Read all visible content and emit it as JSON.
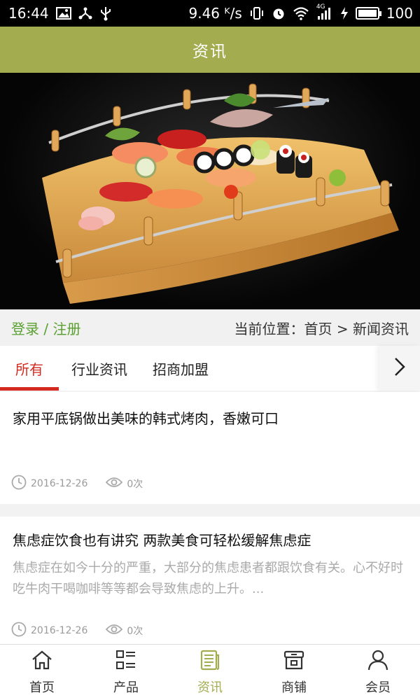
{
  "status_bar": {
    "time": "16:44",
    "speed": "9.46 ᴷ/s",
    "network": "4G",
    "battery": "100",
    "battery_level": 1.0,
    "left_icons": [
      "image-icon",
      "share-icon",
      "usb-icon"
    ],
    "right_icons": [
      "vibrate-icon",
      "alarm-icon",
      "wifi-icon",
      "signal-icon",
      "charging-icon",
      "battery-icon"
    ]
  },
  "header": {
    "title": "资讯"
  },
  "hero": {
    "image_description": "sushi platter on wooden bridge boat"
  },
  "info_bar": {
    "login": "登录",
    "separator": " / ",
    "register": "注册",
    "breadcrumb_label": "当前位置：",
    "breadcrumb_home": "首页",
    "breadcrumb_sep": " > ",
    "breadcrumb_current": "新闻资讯"
  },
  "tabs": [
    {
      "label": "所有",
      "active": true
    },
    {
      "label": "行业资讯",
      "active": false
    },
    {
      "label": "招商加盟",
      "active": false
    }
  ],
  "articles": [
    {
      "title": "家用平底锅做出美味的韩式烤肉，香嫩可口",
      "summary": "",
      "date": "2016-12-26",
      "views": "0次"
    },
    {
      "title": "焦虑症饮食也有讲究 两款美食可轻松缓解焦虑症",
      "summary": "焦虑症在如今十分的严重，大部分的焦虑患者都跟饮食有关。心不好时吃牛肉干喝咖啡等等都会导致焦虑的上升。...",
      "date": "2016-12-26",
      "views": "0次"
    }
  ],
  "bottom_nav": [
    {
      "label": "首页",
      "icon": "home-icon",
      "active": false
    },
    {
      "label": "产品",
      "icon": "grid-list-icon",
      "active": false
    },
    {
      "label": "资讯",
      "icon": "news-icon",
      "active": true
    },
    {
      "label": "商铺",
      "icon": "store-icon",
      "active": false
    },
    {
      "label": "会员",
      "icon": "user-icon",
      "active": false
    }
  ],
  "colors": {
    "header_bg": "#a3ad50",
    "accent_red": "#d42a20",
    "auth_green": "#5aa031",
    "nav_active": "#a3ad50"
  }
}
